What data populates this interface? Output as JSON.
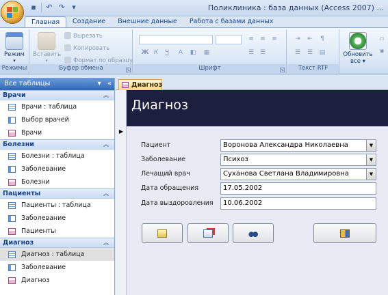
{
  "window": {
    "title": "Поликлиника : база данных (Access 2007) ..."
  },
  "quick_access": {
    "icons": [
      "save-icon",
      "undo-icon",
      "redo-icon",
      "customize-icon"
    ]
  },
  "ribbon_tabs": [
    {
      "label": "Главная",
      "active": true
    },
    {
      "label": "Создание",
      "active": false
    },
    {
      "label": "Внешние данные",
      "active": false
    },
    {
      "label": "Работа с базами данных",
      "active": false
    }
  ],
  "ribbon": {
    "views": {
      "button_label": "Режим",
      "group_label": "Режимы"
    },
    "clipboard": {
      "paste_label": "Вставить",
      "cut_label": "Вырезать",
      "copy_label": "Копировать",
      "format_painter_label": "Формат по образцу",
      "group_label": "Буфер обмена"
    },
    "font": {
      "group_label": "Шрифт",
      "bold": "Ж",
      "italic": "К",
      "underline": "Ч"
    },
    "rich_text": {
      "group_label": "Текст RTF"
    },
    "records": {
      "refresh_label_1": "Обновить",
      "refresh_label_2": "все"
    }
  },
  "nav_pane": {
    "header": "Все таблицы",
    "groups": [
      {
        "title": "Врачи",
        "items": [
          {
            "label": "Врачи : таблица",
            "type": "table"
          },
          {
            "label": "Выбор врачей",
            "type": "query"
          },
          {
            "label": "Врачи",
            "type": "form"
          }
        ]
      },
      {
        "title": "Болезни",
        "items": [
          {
            "label": "Болезни : таблица",
            "type": "table"
          },
          {
            "label": "Заболевание",
            "type": "query"
          },
          {
            "label": "Болезни",
            "type": "form"
          }
        ]
      },
      {
        "title": "Пациенты",
        "items": [
          {
            "label": "Пациенты : таблица",
            "type": "table"
          },
          {
            "label": "Заболевание",
            "type": "query"
          },
          {
            "label": "Пациенты",
            "type": "form"
          }
        ]
      },
      {
        "title": "Диагноз",
        "items": [
          {
            "label": "Диагноз : таблица",
            "type": "table"
          },
          {
            "label": "Заболевание",
            "type": "query"
          },
          {
            "label": "Диагноз",
            "type": "form"
          }
        ]
      }
    ]
  },
  "document": {
    "tab_label": "Диагноз",
    "form_title": "Диагноз",
    "fields": [
      {
        "label": "Пациент",
        "value": "Воронова Александра Николаевна",
        "control": "combo"
      },
      {
        "label": "Заболевание",
        "value": "Психоз",
        "control": "combo"
      },
      {
        "label": "Лечащий врач",
        "value": "Суханова Светлана Владимировна",
        "control": "combo"
      },
      {
        "label": "Дата обращения",
        "value": "17.05.2002",
        "control": "text"
      },
      {
        "label": "Дата выздоровления",
        "value": "10.06.2002",
        "control": "text"
      }
    ],
    "buttons": [
      "new-record-icon",
      "delete-record-icon",
      "find-record-icon",
      "close-form-icon"
    ]
  }
}
